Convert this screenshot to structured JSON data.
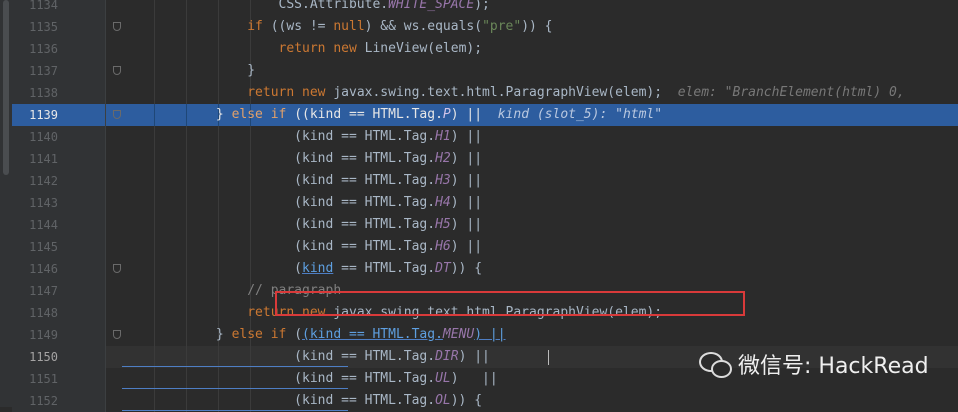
{
  "editor": {
    "lines": [
      {
        "no": "1134",
        "segments": [
          {
            "t": "                    CSS.Attribute.",
            "c": ""
          },
          {
            "t": "WHITE_SPACE",
            "c": "fld"
          },
          {
            "t": ");",
            "c": ""
          }
        ]
      },
      {
        "no": "1135",
        "segments": [
          {
            "t": "                ",
            "c": ""
          },
          {
            "t": "if",
            "c": "kw"
          },
          {
            "t": " ((ws != ",
            "c": ""
          },
          {
            "t": "null",
            "c": "kw"
          },
          {
            "t": ") && ws.equals(",
            "c": ""
          },
          {
            "t": "\"pre\"",
            "c": "str"
          },
          {
            "t": ")) {",
            "c": ""
          }
        ]
      },
      {
        "no": "1136",
        "segments": [
          {
            "t": "                    ",
            "c": ""
          },
          {
            "t": "return new",
            "c": "kw"
          },
          {
            "t": " LineView(elem);",
            "c": ""
          }
        ]
      },
      {
        "no": "1137",
        "segments": [
          {
            "t": "                }",
            "c": ""
          }
        ]
      },
      {
        "no": "1138",
        "segments": [
          {
            "t": "                ",
            "c": ""
          },
          {
            "t": "return new",
            "c": "kw"
          },
          {
            "t": " javax.swing.text.html.ParagraphView(elem);",
            "c": ""
          },
          {
            "t": "  elem: \"BranchElement(html) 0,",
            "c": "hint"
          }
        ]
      },
      {
        "no": "1139",
        "segments": [
          {
            "t": "            } ",
            "c": ""
          },
          {
            "t": "else if",
            "c": "kw"
          },
          {
            "t": " ((kind == HTML.Tag.",
            "c": ""
          },
          {
            "t": "P",
            "c": "fld"
          },
          {
            "t": ") ||  ",
            "c": ""
          },
          {
            "t": "kind (slot_5): \"html\"",
            "c": "hint"
          }
        ]
      },
      {
        "no": "1140",
        "segments": [
          {
            "t": "                      (kind == HTML.Tag.",
            "c": ""
          },
          {
            "t": "H1",
            "c": "fld"
          },
          {
            "t": ") ||",
            "c": ""
          }
        ]
      },
      {
        "no": "1141",
        "segments": [
          {
            "t": "                      (kind == HTML.Tag.",
            "c": ""
          },
          {
            "t": "H2",
            "c": "fld"
          },
          {
            "t": ") ||",
            "c": ""
          }
        ]
      },
      {
        "no": "1142",
        "segments": [
          {
            "t": "                      (kind == HTML.Tag.",
            "c": ""
          },
          {
            "t": "H3",
            "c": "fld"
          },
          {
            "t": ") ||",
            "c": ""
          }
        ]
      },
      {
        "no": "1143",
        "segments": [
          {
            "t": "                      (kind == HTML.Tag.",
            "c": ""
          },
          {
            "t": "H4",
            "c": "fld"
          },
          {
            "t": ") ||",
            "c": ""
          }
        ]
      },
      {
        "no": "1144",
        "segments": [
          {
            "t": "                      (kind == HTML.Tag.",
            "c": ""
          },
          {
            "t": "H5",
            "c": "fld"
          },
          {
            "t": ") ||",
            "c": ""
          }
        ]
      },
      {
        "no": "1145",
        "segments": [
          {
            "t": "                      (kind == HTML.Tag.",
            "c": ""
          },
          {
            "t": "H6",
            "c": "fld"
          },
          {
            "t": ") ||",
            "c": ""
          }
        ]
      },
      {
        "no": "1146",
        "segments": [
          {
            "t": "                      (",
            "c": ""
          },
          {
            "t": "kind",
            "c": "link"
          },
          {
            "t": " == HTML.Tag.",
            "c": ""
          },
          {
            "t": "DT",
            "c": "fld"
          },
          {
            "t": ")) {",
            "c": ""
          }
        ]
      },
      {
        "no": "1147",
        "segments": [
          {
            "t": "                // paragraph",
            "c": "cmt"
          }
        ]
      },
      {
        "no": "1148",
        "segments": [
          {
            "t": "                ",
            "c": ""
          },
          {
            "t": "return new",
            "c": "kw"
          },
          {
            "t": " javax.swing.text.html.ParagraphView(elem);",
            "c": ""
          }
        ]
      },
      {
        "no": "1149",
        "segments": [
          {
            "t": "            } ",
            "c": ""
          },
          {
            "t": "else if",
            "c": "kw"
          },
          {
            "t": " (",
            "c": ""
          },
          {
            "t": "(kind == HTML.Tag.",
            "c": "link"
          },
          {
            "t": "MENU",
            "c": "fld"
          },
          {
            "t": ") ||",
            "c": "link"
          }
        ]
      },
      {
        "no": "1150",
        "segments": [
          {
            "t": "                      (kind == HTML.Tag.",
            "c": ""
          },
          {
            "t": "DIR",
            "c": "fld"
          },
          {
            "t": ") ||",
            "c": ""
          }
        ]
      },
      {
        "no": "1151",
        "segments": [
          {
            "t": "                      (kind == HTML.Tag.",
            "c": ""
          },
          {
            "t": "UL",
            "c": "fld"
          },
          {
            "t": ")   ||",
            "c": ""
          }
        ]
      },
      {
        "no": "1152",
        "segments": [
          {
            "t": "                      (kind == HTML.Tag.",
            "c": ""
          },
          {
            "t": "OL",
            "c": "fld"
          },
          {
            "t": ")) {",
            "c": ""
          }
        ]
      }
    ],
    "execution_line": "1139",
    "current_line": "1150",
    "highlighted_line": "1148"
  },
  "watermark": {
    "icon": "wechat-icon",
    "label": "微信号: HackRead"
  },
  "colors": {
    "keyword": "#cc7832",
    "string": "#6a8759",
    "field": "#9876aa",
    "comment": "#808080",
    "inline_hint": "#787878",
    "execution_highlight": "#2d5d9f",
    "annotation_box": "#d93a3a"
  }
}
